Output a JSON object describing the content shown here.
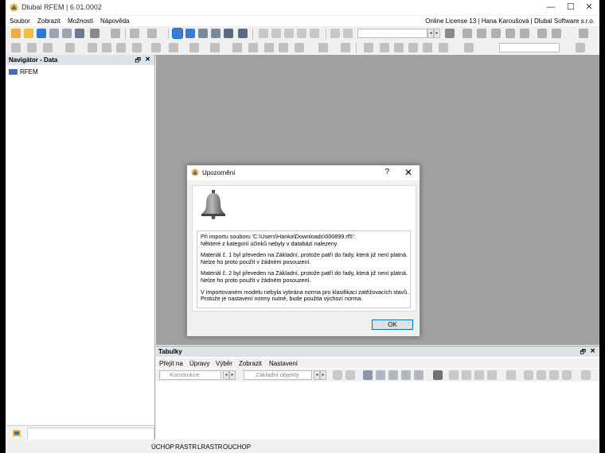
{
  "window": {
    "title": "Dlubal RFEM | 6.01.0002",
    "license": "Online License 13 | Hana Karoušová | Dlubal Software s.r.o."
  },
  "menu": [
    "Soubor",
    "Zobrazit",
    "Možnosti",
    "Nápověda"
  ],
  "navigator": {
    "title": "Navigátor - Data",
    "item": "RFEM"
  },
  "tables": {
    "title": "Tabulky",
    "menu": [
      "Přejít na",
      "Úpravy",
      "Výběr",
      "Zobrazit",
      "Nastavení"
    ],
    "combo1": "Konstrukce",
    "combo2": "Základní objekty"
  },
  "status": [
    "ÚCHOP",
    "RASTR",
    "LRASTR",
    "OUCHOP"
  ],
  "dialog": {
    "title": "Upozornění",
    "help": "?",
    "close": "✕",
    "paragraphs": [
      "Při importu souboru 'C:\\Users\\Hanka\\Downloads\\000899.rf5':\nNěkteré z kategorií účinků nebyly v databázi nalezeny.",
      "Materiál č. 1 byl převeden na Základní, protože patří do řady, která již není platná. Nelze ho proto použít v žádném posouzení.",
      "Materiál č. 2 byl převeden na Základní, protože patří do řady, která již není platná. Nelze ho proto použít v žádném posouzení.",
      "V importovaném modelu nebyla vybrána norma pro klasifikaci zatěžovacích stavů. Protože je nastavení normy nutné, bude použita výchozí norma."
    ],
    "ok": "OK"
  },
  "colors": {
    "workspace": "#a0a0a0",
    "panel_header": "#dde3ea",
    "accent": "#0078d7"
  }
}
